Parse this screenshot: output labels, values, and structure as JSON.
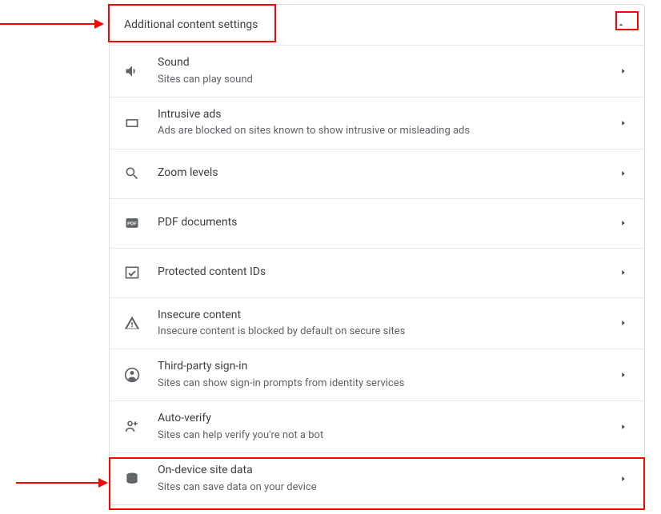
{
  "header": {
    "title": "Additional content settings"
  },
  "items": [
    {
      "icon": "sound",
      "title": "Sound",
      "sub": "Sites can play sound"
    },
    {
      "icon": "rect",
      "title": "Intrusive ads",
      "sub": "Ads are blocked on sites known to show intrusive or misleading ads"
    },
    {
      "icon": "search",
      "title": "Zoom levels",
      "sub": ""
    },
    {
      "icon": "pdf",
      "title": "PDF documents",
      "sub": ""
    },
    {
      "icon": "protected",
      "title": "Protected content IDs",
      "sub": ""
    },
    {
      "icon": "warning",
      "title": "Insecure content",
      "sub": "Insecure content is blocked by default on secure sites"
    },
    {
      "icon": "person",
      "title": "Third-party sign-in",
      "sub": "Sites can show sign-in prompts from identity services"
    },
    {
      "icon": "autoverify",
      "title": "Auto-verify",
      "sub": "Sites can help verify you're not a bot"
    },
    {
      "icon": "storage",
      "title": "On-device site data",
      "sub": "Sites can save data on your device"
    }
  ],
  "annotations": {
    "highlight_color": "#ff0000"
  }
}
